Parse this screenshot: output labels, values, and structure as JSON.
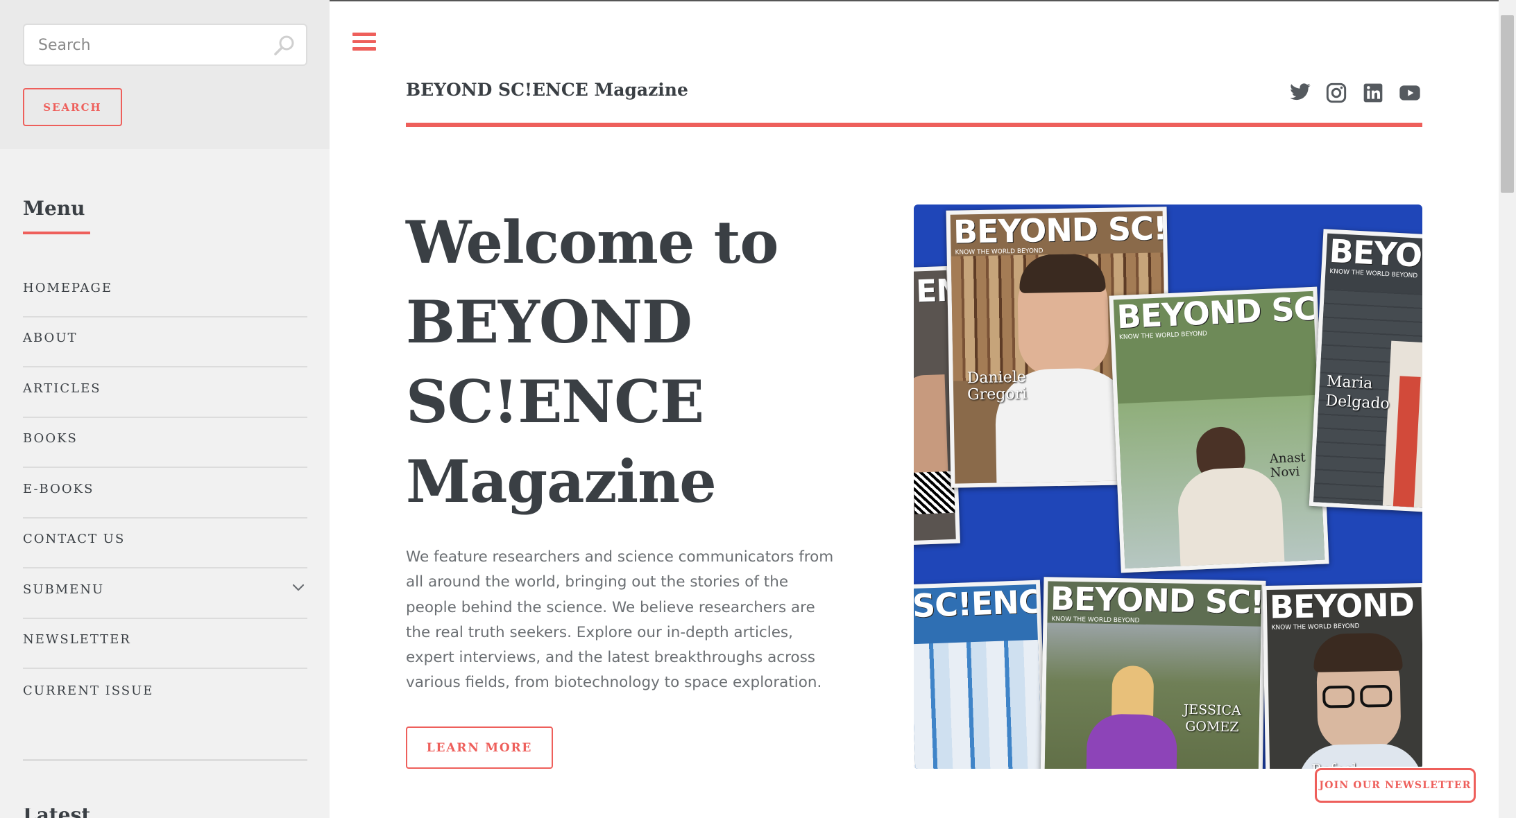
{
  "sidebar": {
    "search": {
      "placeholder": "Search",
      "value": "",
      "button_label": "SEARCH"
    },
    "menu_title": "Menu",
    "menu_items": [
      {
        "label": "HOMEPAGE"
      },
      {
        "label": "ABOUT"
      },
      {
        "label": "ARTICLES"
      },
      {
        "label": "BOOKS"
      },
      {
        "label": "E-BOOKS"
      },
      {
        "label": "CONTACT US"
      },
      {
        "label": "SUBMENU",
        "has_children": true
      },
      {
        "label": "NEWSLETTER"
      },
      {
        "label": "CURRENT ISSUE"
      }
    ],
    "next_widget_title": "Latest News"
  },
  "header": {
    "site_title": "BEYOND SC!ENCE Magazine",
    "social_icons": [
      "twitter-icon",
      "instagram-icon",
      "linkedin-icon",
      "youtube-icon"
    ]
  },
  "hero": {
    "title_lines": [
      "Welcome to",
      "BEYOND",
      "SC!ENCE",
      "Magazine"
    ],
    "description": "We feature researchers and science communicators from all around the world, bringing out the stories of the people behind the science. We believe researchers are the real truth seekers. Explore our in-depth articles, expert interviews, and the latest breakthroughs across various fields, from biotechnology to space exploration.",
    "button_label": "LEARN MORE",
    "image": {
      "covers": [
        {
          "masthead": "!EN"
        },
        {
          "masthead": "BEYOND SC!ENCE",
          "tagline": "KNOW THE WORLD BEYOND",
          "person": "Daniele Gregori"
        },
        {
          "masthead": "BEYOND SC!ENC",
          "tagline": "KNOW THE WORLD BEYOND",
          "person": "Anast Novi"
        },
        {
          "masthead": "BEYOND",
          "tagline": "KNOW THE WORLD BEYOND",
          "person": "Maria Delgado"
        },
        {
          "masthead": "SC!ENCE"
        },
        {
          "masthead": "BEYOND SC!ENCE",
          "tagline": "KNOW THE WORLD BEYOND",
          "person": "JESSICA GOMEZ"
        },
        {
          "masthead": "BEYOND SC!",
          "tagline": "KNOW THE WORLD BEYOND",
          "person": "Rafael"
        }
      ]
    }
  },
  "newsletter_button": "JOIN OUR NEWSLETTER",
  "colors": {
    "accent": "#ee5f5b",
    "text": "#3a3f44",
    "sidebar_bg": "#f1f1f1",
    "image_bg": "#1f46b8"
  }
}
